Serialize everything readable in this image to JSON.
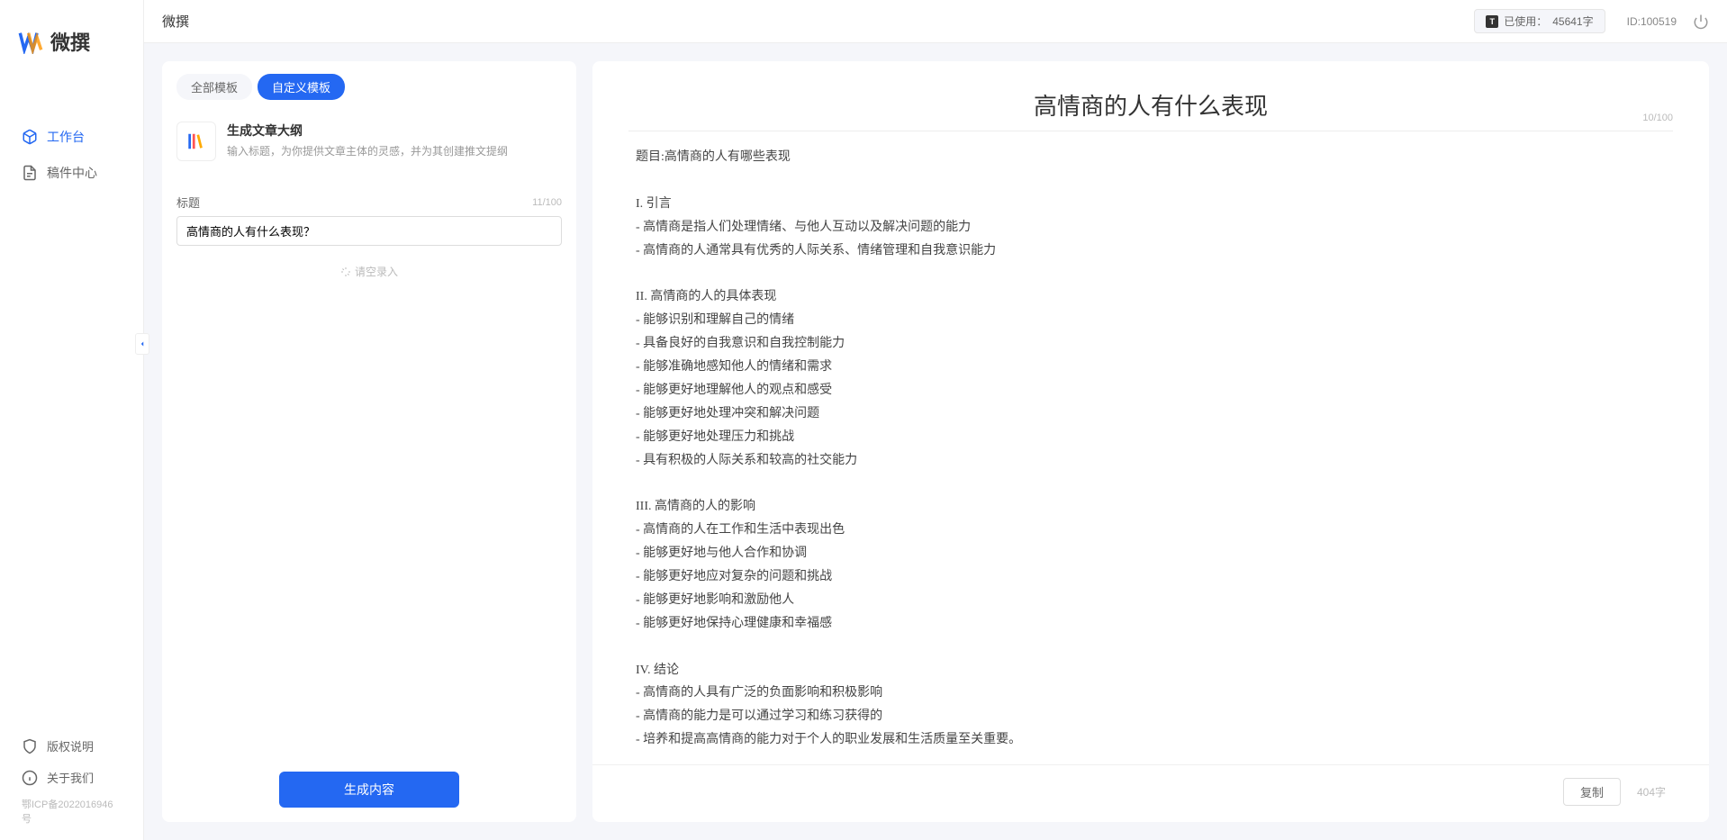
{
  "app_name": "微撰",
  "logo_text": "微撰",
  "topbar": {
    "usage_label": "已使用：",
    "usage_value": "45641字",
    "user_id_label": "ID:100519"
  },
  "sidebar": {
    "items": [
      {
        "label": "工作台",
        "active": true
      },
      {
        "label": "稿件中心",
        "active": false
      }
    ],
    "footer": [
      {
        "label": "版权说明"
      },
      {
        "label": "关于我们"
      }
    ],
    "icp": "鄂ICP备2022016946号"
  },
  "left_panel": {
    "tabs": [
      {
        "label": "全部模板",
        "active": false
      },
      {
        "label": "自定义模板",
        "active": true
      }
    ],
    "template": {
      "title": "生成文章大纲",
      "desc": "输入标题，为你提供文章主体的灵感，并为其创建推文提纲"
    },
    "field": {
      "label": "标题",
      "count": "11/100",
      "value": "高情商的人有什么表现？"
    },
    "empty_hint": "请空录入",
    "generate_btn": "生成内容"
  },
  "output": {
    "title": "高情商的人有什么表现",
    "title_count": "10/100",
    "body": "题目:高情商的人有哪些表现\n\nI. 引言\n- 高情商是指人们处理情绪、与他人互动以及解决问题的能力\n- 高情商的人通常具有优秀的人际关系、情绪管理和自我意识能力\n\nII. 高情商的人的具体表现\n- 能够识别和理解自己的情绪\n- 具备良好的自我意识和自我控制能力\n- 能够准确地感知他人的情绪和需求\n- 能够更好地理解他人的观点和感受\n- 能够更好地处理冲突和解决问题\n- 能够更好地处理压力和挑战\n- 具有积极的人际关系和较高的社交能力\n\nIII. 高情商的人的影响\n- 高情商的人在工作和生活中表现出色\n- 能够更好地与他人合作和协调\n- 能够更好地应对复杂的问题和挑战\n- 能够更好地影响和激励他人\n- 能够更好地保持心理健康和幸福感\n\nIV. 结论\n- 高情商的人具有广泛的负面影响和积极影响\n- 高情商的能力是可以通过学习和练习获得的\n- 培养和提高高情商的能力对于个人的职业发展和生活质量至关重要。",
    "copy_btn": "复制",
    "word_count": "404字"
  }
}
